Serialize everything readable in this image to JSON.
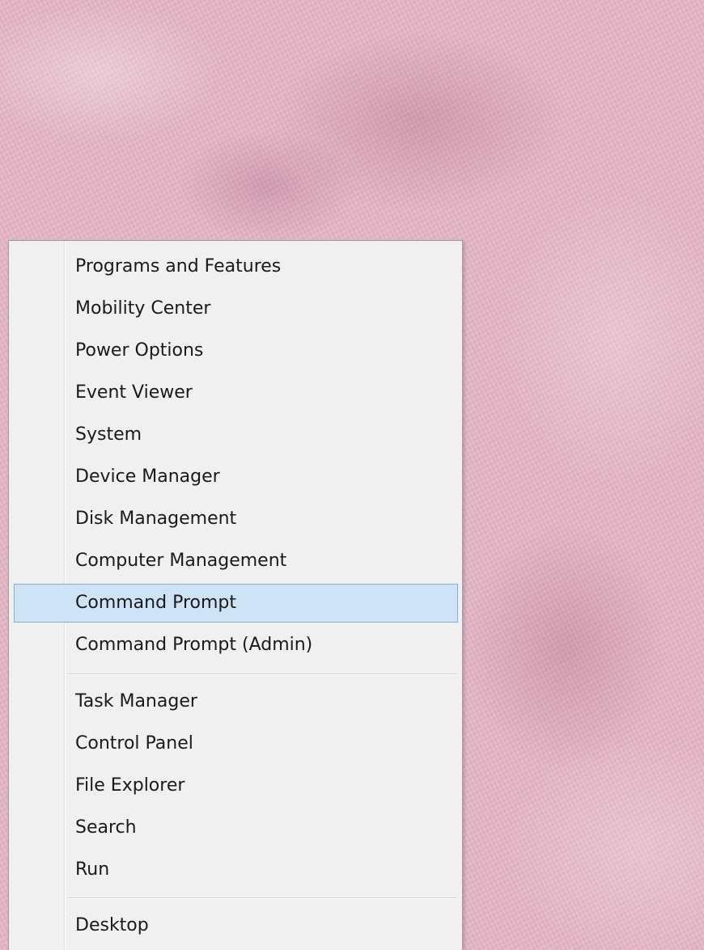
{
  "desktop": {
    "background_color": "#e5b6c6"
  },
  "menu": {
    "groups": [
      {
        "items": [
          {
            "label": "Programs and Features",
            "highlighted": false
          },
          {
            "label": "Mobility Center",
            "highlighted": false
          },
          {
            "label": "Power Options",
            "highlighted": false
          },
          {
            "label": "Event Viewer",
            "highlighted": false
          },
          {
            "label": "System",
            "highlighted": false
          },
          {
            "label": "Device Manager",
            "highlighted": false
          },
          {
            "label": "Disk Management",
            "highlighted": false
          },
          {
            "label": "Computer Management",
            "highlighted": false
          },
          {
            "label": "Command Prompt",
            "highlighted": true
          },
          {
            "label": "Command Prompt (Admin)",
            "highlighted": false
          }
        ]
      },
      {
        "items": [
          {
            "label": "Task Manager",
            "highlighted": false
          },
          {
            "label": "Control Panel",
            "highlighted": false
          },
          {
            "label": "File Explorer",
            "highlighted": false
          },
          {
            "label": "Search",
            "highlighted": false
          },
          {
            "label": "Run",
            "highlighted": false
          }
        ]
      },
      {
        "items": [
          {
            "label": "Desktop",
            "highlighted": false
          }
        ]
      }
    ],
    "highlight_color": "#cfe3f6",
    "highlight_border_color": "#84acd6"
  }
}
